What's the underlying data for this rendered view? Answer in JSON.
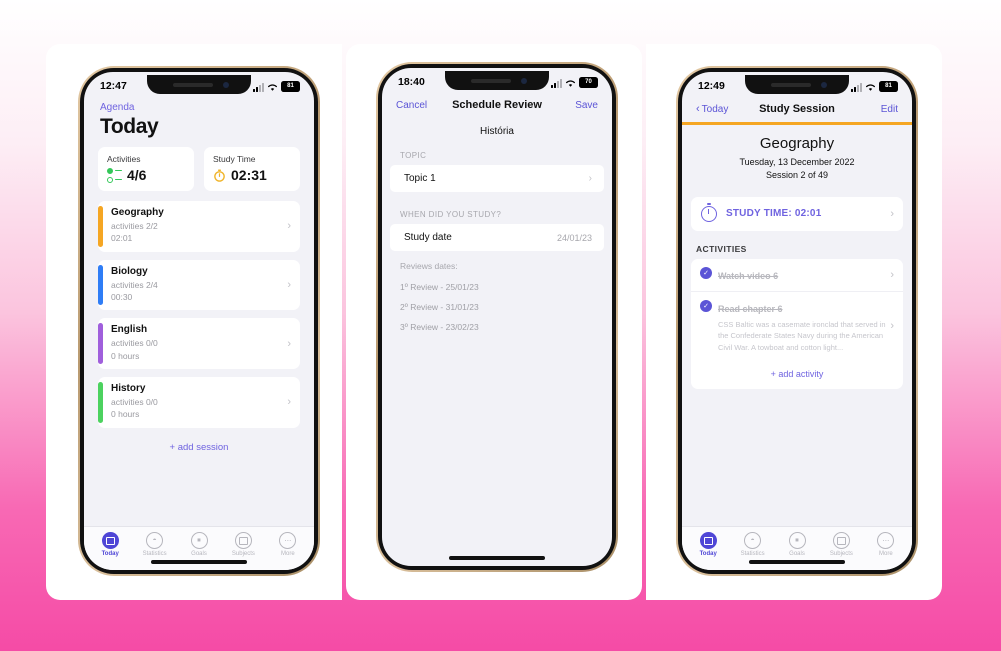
{
  "screen1": {
    "status": {
      "time": "12:47",
      "battery": "81"
    },
    "breadcrumb": "Agenda",
    "title": "Today",
    "stats": [
      {
        "label": "Activities",
        "value": "4/6",
        "icon": "list-icon"
      },
      {
        "label": "Study Time",
        "value": "02:31",
        "icon": "stopwatch-icon"
      }
    ],
    "sessions": [
      {
        "subject": "Geography",
        "activities": "activities 2/2",
        "duration": "02:01",
        "color": "#f5a623"
      },
      {
        "subject": "Biology",
        "activities": "activities 2/4",
        "duration": "00:30",
        "color": "#2f7df6"
      },
      {
        "subject": "English",
        "activities": "activities 0/0",
        "duration": "0 hours",
        "color": "#a05fdc"
      },
      {
        "subject": "History",
        "activities": "activities 0/0",
        "duration": "0 hours",
        "color": "#4cd25f"
      }
    ],
    "add_session": "+ add session"
  },
  "screen2": {
    "status": {
      "time": "18:40",
      "battery": "70"
    },
    "cancel": "Cancel",
    "nav_title": "Schedule Review",
    "save": "Save",
    "subject": "História",
    "topic_label": "TOPIC",
    "topic_value": "Topic 1",
    "when_label": "WHEN DID YOU STUDY?",
    "study_date_label": "Study date",
    "study_date_value": "24/01/23",
    "reviews_label": "Reviews dates:",
    "reviews": [
      "1º Review - 25/01/23",
      "2º Review - 31/01/23",
      "3º Review - 23/02/23"
    ]
  },
  "screen3": {
    "status": {
      "time": "12:49",
      "battery": "81"
    },
    "back": "Today",
    "nav_title": "Study Session",
    "edit": "Edit",
    "subject": "Geography",
    "date": "Tuesday, 13 December 2022",
    "session_count": "Session 2 of 49",
    "study_time": "STUDY TIME: 02:01",
    "activities_label": "ACTIVITIES",
    "activities": [
      {
        "title": "Watch video 6",
        "desc": ""
      },
      {
        "title": "Read chapter 6",
        "desc": "CSS Baltic was a casemate ironclad that served in the Confederate States Navy during the American Civil War. A towboat and cotton light..."
      }
    ],
    "add_activity": "+ add activity"
  },
  "tabbar": {
    "items": [
      {
        "label": "Today",
        "icon": "today-icon",
        "active": true
      },
      {
        "label": "Statistics",
        "icon": "chart-icon",
        "active": false
      },
      {
        "label": "Goals",
        "icon": "flag-icon",
        "active": false
      },
      {
        "label": "Subjects",
        "icon": "books-icon",
        "active": false
      },
      {
        "label": "More",
        "icon": "ellipsis-icon",
        "active": false
      }
    ]
  },
  "colors": {
    "accent": "#5b54d6",
    "orange": "#f5a623",
    "green": "#34c759"
  }
}
